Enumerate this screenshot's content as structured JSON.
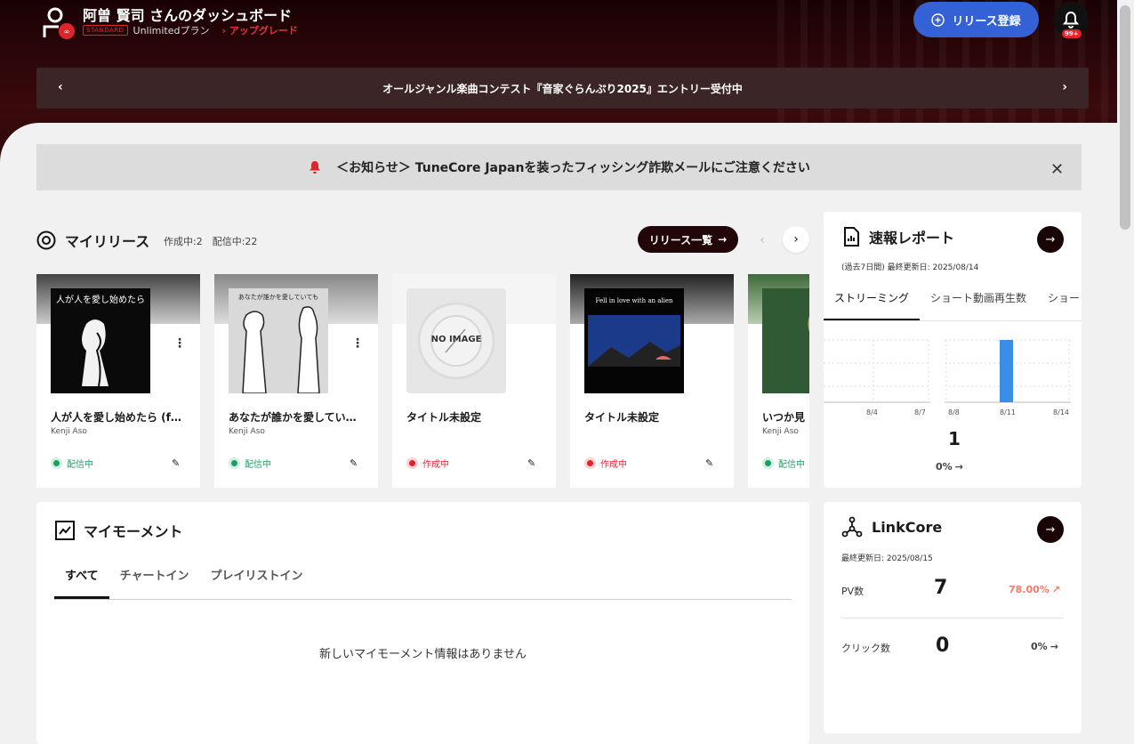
{
  "header": {
    "dashboard_title": "阿曽 賢司 さんのダッシュボード",
    "plan_badge": "STANDARD",
    "plan_name": "Unlimitedプラン",
    "upgrade_label": "アップグレード",
    "release_button": "リリース登録",
    "notification_count": "99+"
  },
  "banner": {
    "text": "オールジャンル楽曲コンテスト『音家ぐらんぷり2025』エントリー受付中"
  },
  "notice": {
    "text": "＜お知らせ＞ TuneCore Japanを装ったフィッシング詐欺メールにご注意ください"
  },
  "my_releases": {
    "title": "マイリリース",
    "counts": "作成中:2　配信中:22",
    "list_button": "リリース一覧",
    "cards": [
      {
        "title": "人が人を愛し始めたら (f…",
        "artist": "Kenji Aso",
        "status": "配信中",
        "status_color": "#1f9d68",
        "jacket_text": "人が人を愛し始めたら"
      },
      {
        "title": "あなたが誰かを愛してい…",
        "artist": "Kenji Aso",
        "status": "配信中",
        "status_color": "#1f9d68",
        "jacket_text": "あなたが誰かを愛していても"
      },
      {
        "title": "タイトル未設定",
        "artist": "",
        "status": "作成中",
        "status_color": "#e0242c",
        "jacket_text": "NO IMAGE"
      },
      {
        "title": "タイトル未設定",
        "artist": "",
        "status": "作成中",
        "status_color": "#e0242c",
        "jacket_text": "Fell in love with an alien"
      },
      {
        "title": "いつか見",
        "artist": "Kenji Aso",
        "status": "配信中",
        "status_color": "#1f9d68",
        "jacket_text": ""
      }
    ]
  },
  "quick_report": {
    "title": "速報レポート",
    "subtitle": "(過去7日間) 最終更新日: 2025/08/14",
    "tabs": [
      "ストリーミング",
      "ショート動画再生数",
      "ショー"
    ],
    "chart_left_ticks": [
      "8/4",
      "8/7"
    ],
    "chart_right_ticks": [
      "8/8",
      "8/11",
      "8/14"
    ],
    "total": "1",
    "change": "0%"
  },
  "my_moment": {
    "title": "マイモーメント",
    "tabs": [
      "すべて",
      "チャートイン",
      "プレイリストイン"
    ],
    "empty_text": "新しいマイモーメント情報はありません"
  },
  "linkcore": {
    "title": "LinkCore",
    "updated": "最終更新日: 2025/08/15",
    "pv_label": "PV数",
    "pv_value": "7",
    "pv_change": "78.00%",
    "click_label": "クリック数",
    "click_value": "0",
    "click_change": "0%"
  },
  "chart_data": {
    "type": "bar",
    "categories": [
      "8/8",
      "8/11",
      "8/14"
    ],
    "values": [
      0,
      1,
      0
    ]
  }
}
